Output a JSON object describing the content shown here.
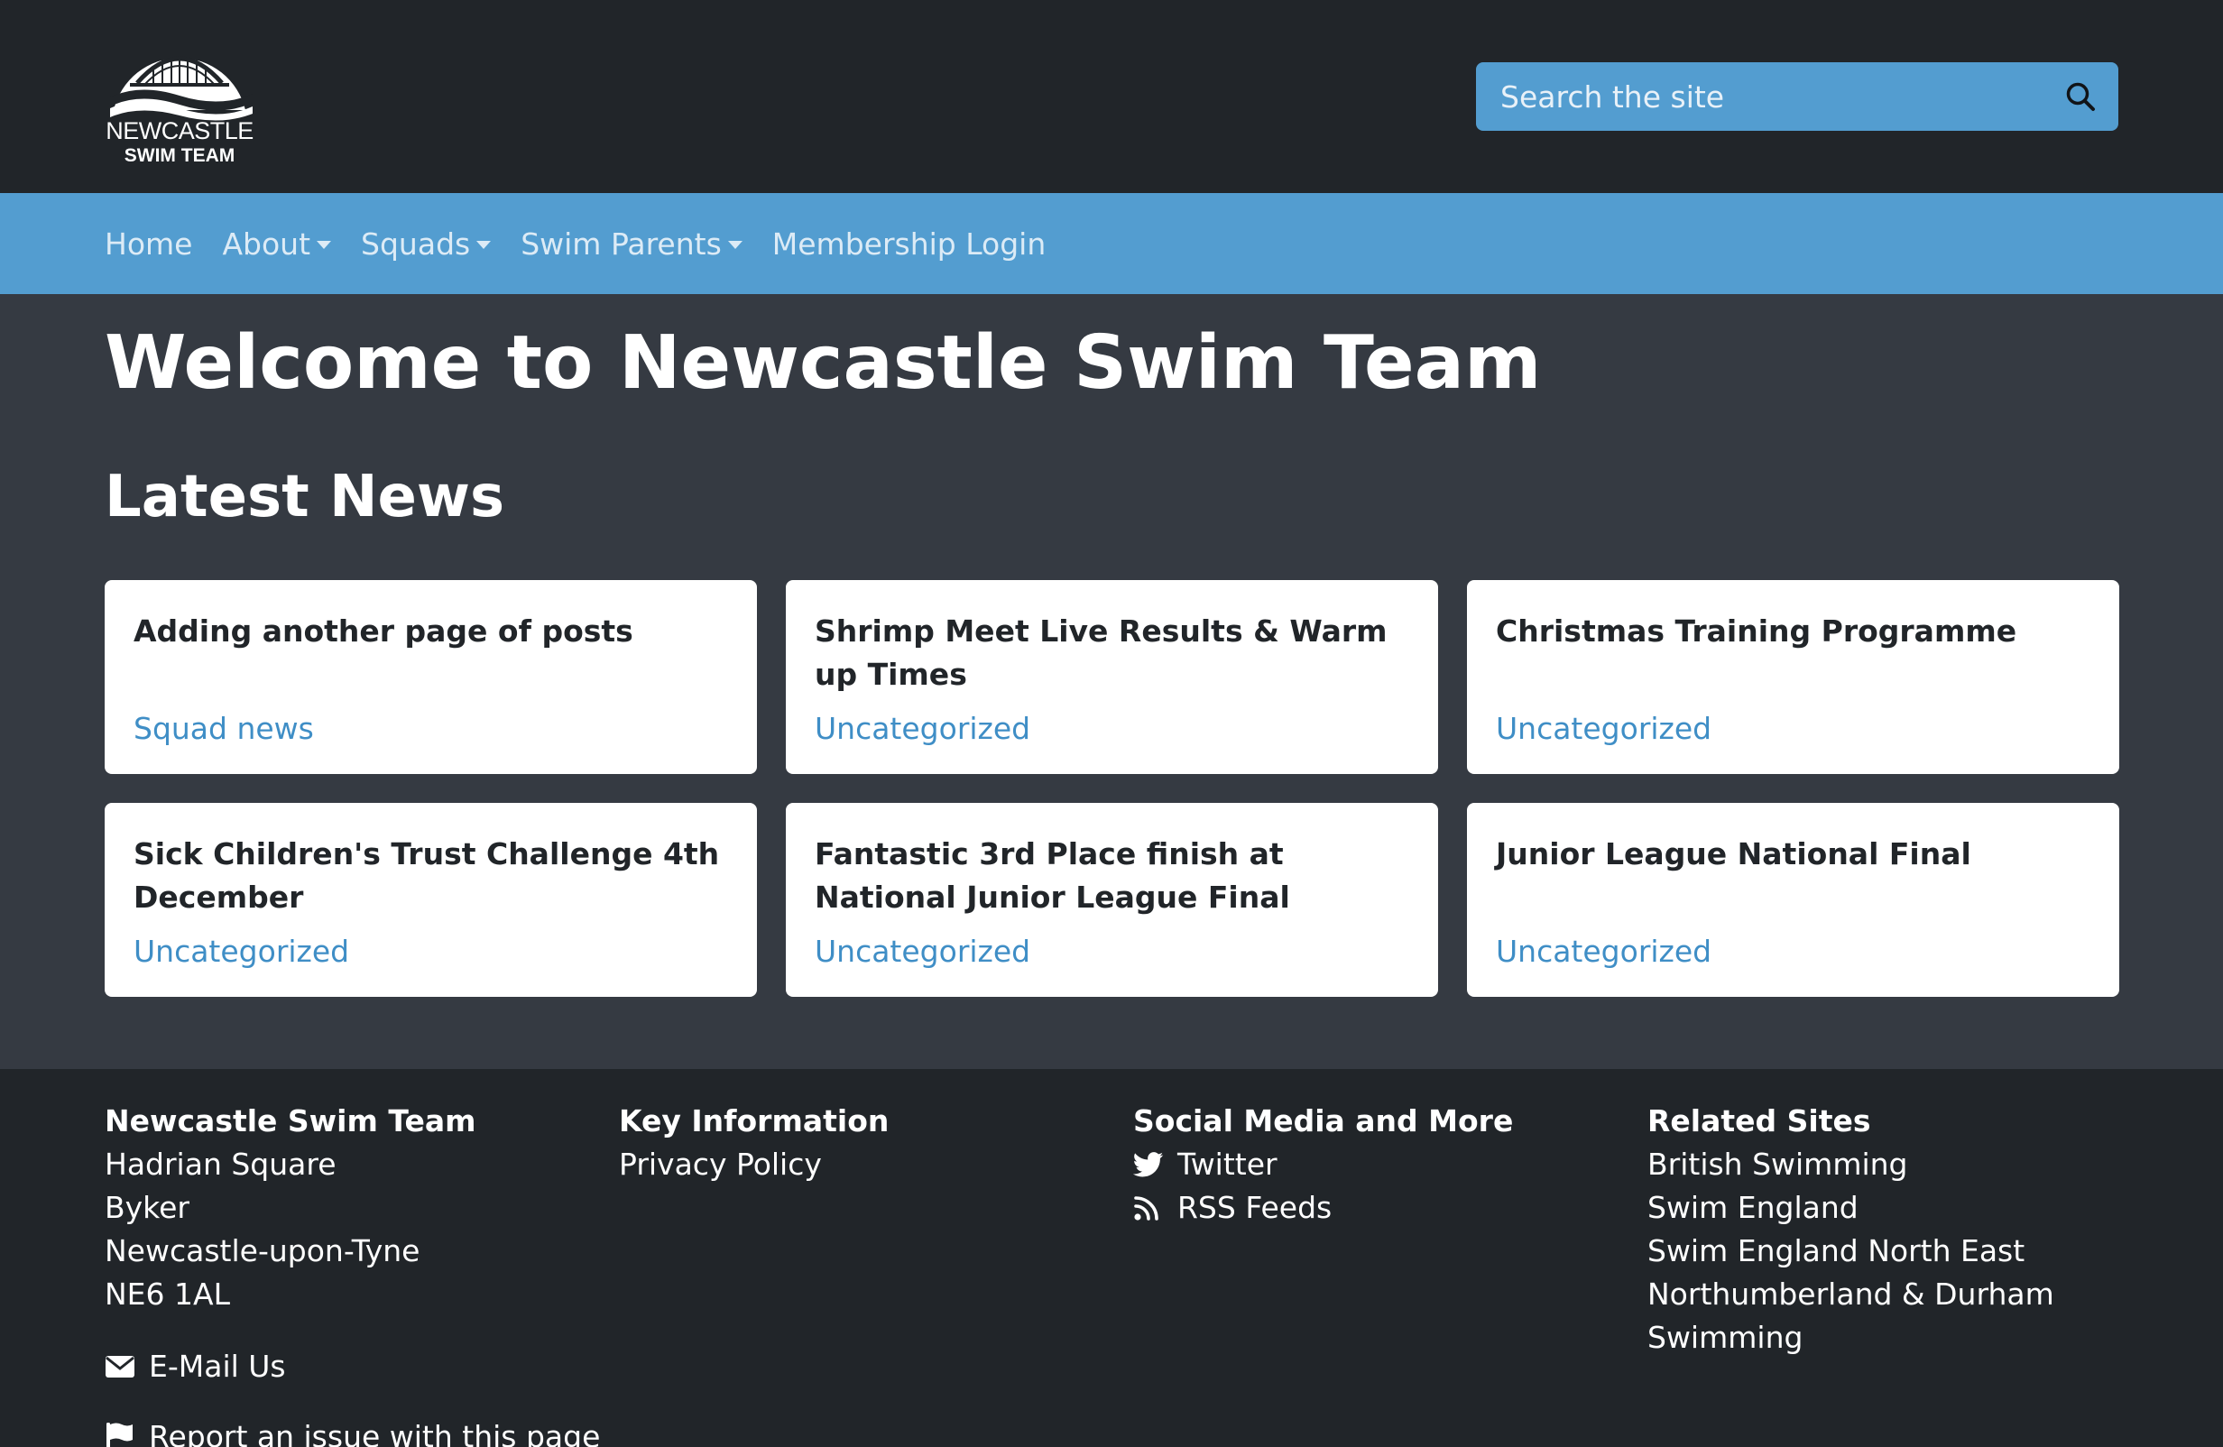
{
  "header": {
    "logo": {
      "line1": "NEWCASTLE",
      "line2": "SWIM TEAM"
    },
    "search": {
      "placeholder": "Search the site"
    }
  },
  "nav": {
    "items": [
      {
        "label": "Home",
        "dropdown": false
      },
      {
        "label": "About",
        "dropdown": true
      },
      {
        "label": "Squads",
        "dropdown": true
      },
      {
        "label": "Swim Parents",
        "dropdown": true
      },
      {
        "label": "Membership Login",
        "dropdown": false
      }
    ]
  },
  "main": {
    "title": "Welcome to Newcastle Swim Team",
    "news_heading": "Latest News",
    "news": [
      {
        "title": "Adding another page of posts",
        "category": "Squad news"
      },
      {
        "title": "Shrimp Meet Live Results & Warm up Times",
        "category": "Uncategorized"
      },
      {
        "title": "Christmas Training Programme",
        "category": "Uncategorized"
      },
      {
        "title": "Sick Children's Trust Challenge 4th December",
        "category": "Uncategorized"
      },
      {
        "title": "Fantastic 3rd Place finish at National Junior League Final",
        "category": "Uncategorized"
      },
      {
        "title": "Junior League National Final",
        "category": "Uncategorized"
      }
    ]
  },
  "footer": {
    "club": {
      "heading": "Newcastle Swim Team",
      "address": [
        "Hadrian Square",
        "Byker",
        "Newcastle-upon-Tyne",
        "NE6 1AL"
      ],
      "email_label": "E-Mail Us",
      "report_label": "Report an issue with this page"
    },
    "key_info": {
      "heading": "Key Information",
      "links": [
        "Privacy Policy"
      ]
    },
    "social": {
      "heading": "Social Media and More",
      "twitter_label": "Twitter",
      "rss_label": "RSS Feeds"
    },
    "related": {
      "heading": "Related Sites",
      "links": [
        "British Swimming",
        "Swim England",
        "Swim England North East",
        "Northumberland & Durham Swimming"
      ]
    }
  },
  "colors": {
    "header_bg": "#212529",
    "nav_bg": "#539dd0",
    "page_bg": "#353a42",
    "link_blue": "#3f8ec6"
  },
  "icons": {
    "search": "search-icon",
    "email": "envelope-icon",
    "report": "flag-icon",
    "twitter": "twitter-icon",
    "rss": "rss-icon"
  }
}
